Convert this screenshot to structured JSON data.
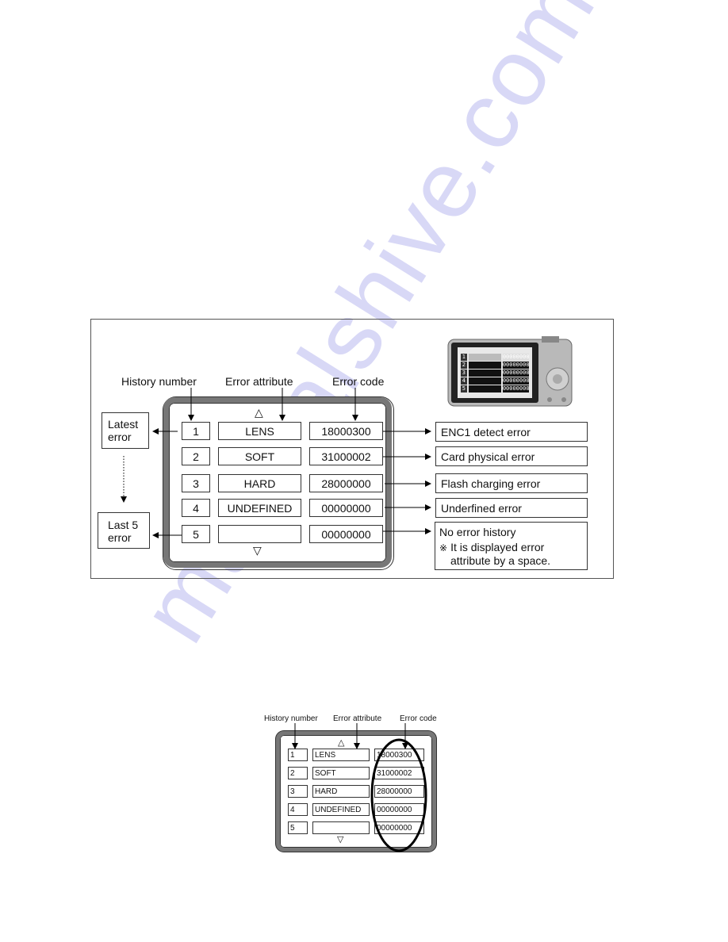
{
  "watermark": "manualshive.com",
  "main_figure": {
    "header_labels": {
      "history_number": "History number",
      "error_attribute": "Error attribute",
      "error_code": "Error code"
    },
    "side_labels": {
      "latest_error": [
        "Latest",
        "error"
      ],
      "last5_error": [
        "Last 5",
        "error"
      ]
    },
    "scroll_up": "△",
    "scroll_down": "▽",
    "rows": [
      {
        "number": "1",
        "attribute": "LENS",
        "code": "18000300",
        "description": "ENC1 detect error"
      },
      {
        "number": "2",
        "attribute": "SOFT",
        "code": "31000002",
        "description": "Card physical error"
      },
      {
        "number": "3",
        "attribute": "HARD",
        "code": "28000000",
        "description": "Flash charging error"
      },
      {
        "number": "4",
        "attribute": "UNDEFINED",
        "code": "00000000",
        "description": "Underfined error"
      },
      {
        "number": "5",
        "attribute": "",
        "code": "00000000",
        "description": "No error history"
      }
    ],
    "note_mark": "※",
    "note_lines": [
      "It is displayed error",
      "attribute by a space."
    ],
    "camera_screen": {
      "numbers": [
        "1",
        "2",
        "3",
        "4",
        "5"
      ],
      "codes": [
        "00000000",
        "00000000",
        "00000000",
        "00000000",
        "00000000"
      ]
    }
  },
  "small_figure": {
    "header_labels": {
      "history_number": "History number",
      "error_attribute": "Error attribute",
      "error_code": "Error code"
    },
    "scroll_up": "△",
    "scroll_down": "▽",
    "rows": [
      {
        "number": "1",
        "attribute": "LENS",
        "code": "18000300"
      },
      {
        "number": "2",
        "attribute": "SOFT",
        "code": "31000002"
      },
      {
        "number": "3",
        "attribute": "HARD",
        "code": "28000000"
      },
      {
        "number": "4",
        "attribute": "UNDEFINED",
        "code": "00000000"
      },
      {
        "number": "5",
        "attribute": "",
        "code": "00000000"
      }
    ]
  }
}
